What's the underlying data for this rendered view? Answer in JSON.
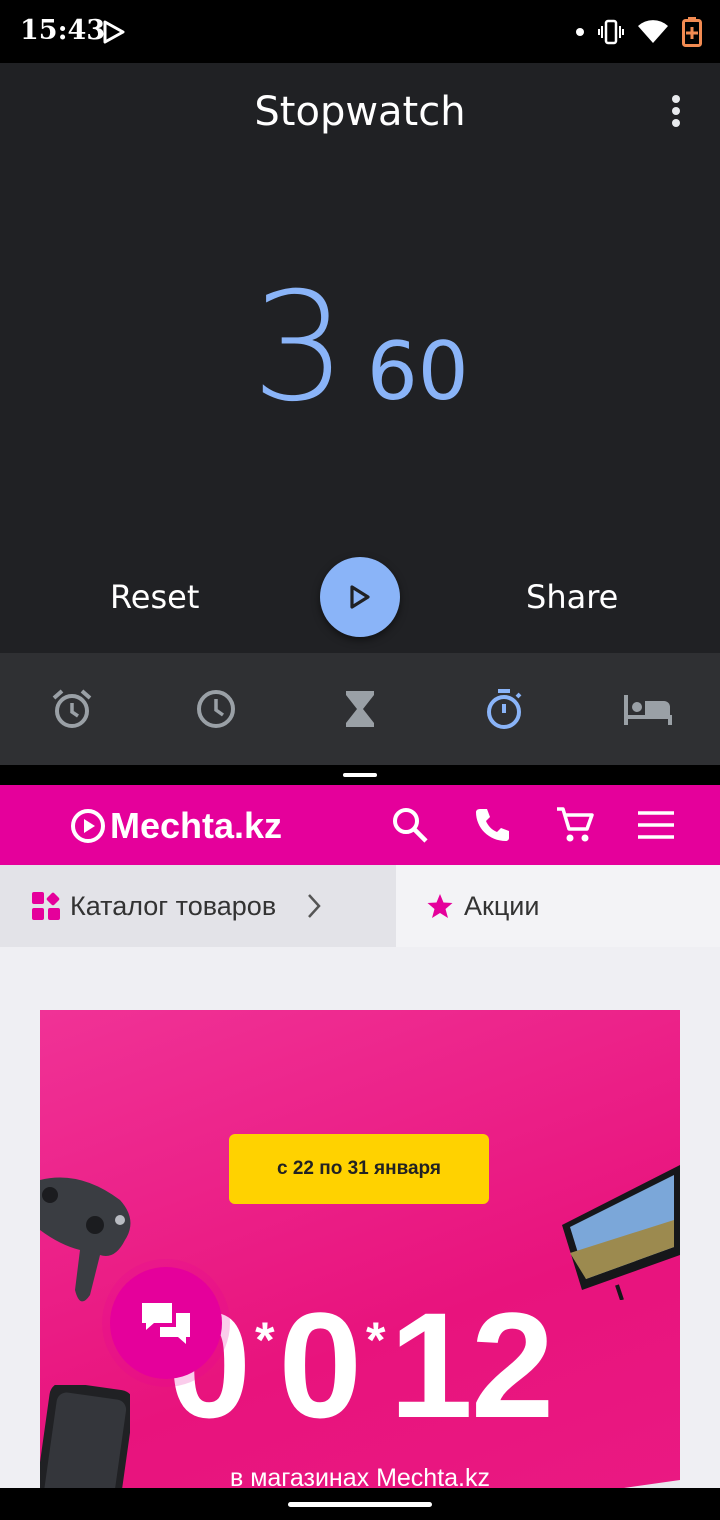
{
  "status_bar": {
    "time": "15:43",
    "icons": [
      "play-store-icon",
      "notification-dot",
      "vibrate-icon",
      "wifi-icon",
      "battery-saver-icon"
    ]
  },
  "clock_app": {
    "title": "Stopwatch",
    "time_seconds": "3",
    "time_hundredths": "60",
    "reset_label": "Reset",
    "share_label": "Share",
    "accent_color": "#8ab4f8",
    "tabs": [
      {
        "name": "alarm-icon",
        "active": false
      },
      {
        "name": "clock-icon",
        "active": false
      },
      {
        "name": "timer-icon",
        "active": false
      },
      {
        "name": "stopwatch-icon",
        "active": true
      },
      {
        "name": "bedtime-icon",
        "active": false
      }
    ]
  },
  "mechta": {
    "logo": "Mechta.kz",
    "brand_color": "#e5009b",
    "catalog_label": "Каталог товаров",
    "promo_label": "Акции",
    "banner": {
      "date_text": "с 22 по 31 января",
      "big_0": "0",
      "big_1": "0",
      "big_2": "12",
      "star": "*",
      "subtitle": "в магазинах Mechta.kz"
    }
  }
}
